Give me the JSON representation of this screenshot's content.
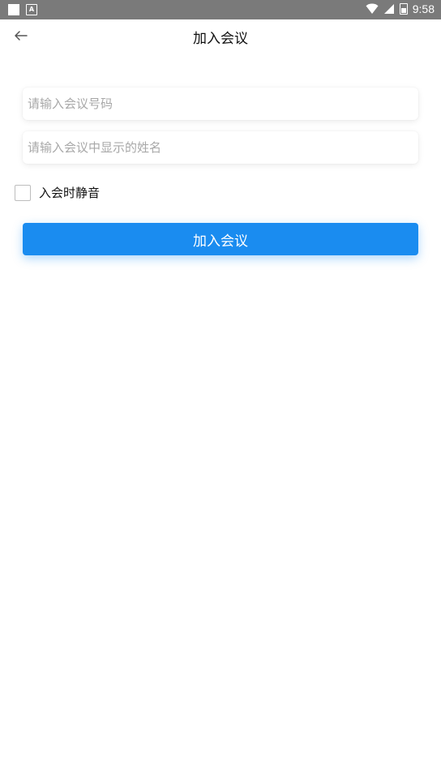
{
  "status_bar": {
    "time": "9:58",
    "left_icons": [
      "white-square-icon",
      "a-badge-icon"
    ],
    "right_icons": [
      "wifi-icon",
      "signal-icon",
      "battery-icon"
    ],
    "a_badge_text": "A"
  },
  "header": {
    "back_icon": "arrow-left-icon",
    "title": "加入会议"
  },
  "form": {
    "meeting_id": {
      "placeholder": "请输入会议号码",
      "value": ""
    },
    "display_name": {
      "placeholder": "请输入会议中显示的姓名",
      "value": ""
    },
    "mute_on_join": {
      "label": "入会时静音",
      "checked": false
    },
    "join_button_label": "加入会议"
  },
  "colors": {
    "status_bar_bg": "#7a7a7a",
    "primary": "#1a8cf0",
    "placeholder": "#a8a8a8"
  }
}
